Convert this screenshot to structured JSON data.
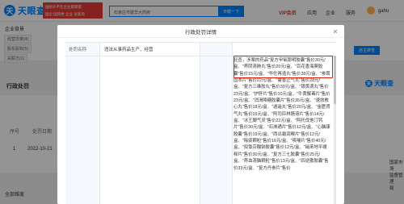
{
  "header": {
    "logo_text": "天眼查",
    "promo_lines": [
      "国际外不在企业家联盟",
      "国企 国资委 企业 试查询"
    ],
    "search_text": "石家庄市建华大药房",
    "search_button": "天眼一下",
    "vip": "VIP会员",
    "nav": [
      "应用",
      "企业",
      "服务"
    ],
    "user": "gahu"
  },
  "background": {
    "tab_title": "企业背景",
    "chips_row1": [
      "经营异常(4)",
      "股东股权(5)"
    ],
    "chips_row2": [
      "关联方(1)"
    ],
    "blue_button": "自主排查",
    "section_title": "行政处罚",
    "watermark": "天眼查",
    "table_headers": [
      "序号",
      "处罚日期"
    ],
    "row": {
      "index": "1",
      "date": "2022-10-21"
    },
    "side_text": [
      "国家市场",
      "监督管理",
      "局"
    ],
    "bottom_label": "全部维度"
  },
  "modal": {
    "title": "行政处罚详情",
    "close_icon": "close-icon",
    "rows": [
      {
        "label": "处罚名称",
        "value": "违法从事药品生产、经营"
      }
    ],
    "content": "经查，涉案的药品\"复方甲氧那明胶囊\"售价30元/盒、\"养阴清肺丸\"售价20元/盒、\"百花香海葵胶囊\"售价15元/盒、\"华佗再造丸\"售价28元/盒、\"参茸固本片\"售价22元/盒、\"藿香正气丸\"售价28元/盒、\"复方三维胶丸\"售价30元/盒、\"银黄滴丸\"售价23元/盒、\"护肝片\"售价10元/盒、\"牛黄解毒片\"售价23元/盒、\"消渴降糖胶囊片\"售价35元/盒、\"速效救心丸\"售价18元/盒、\"逍遥丸\"售价20元/盒、\"金匮肾气丸\"售价15元/盒、\"阿司匹林肠溶片\"售价14元/盒、\"冰王脚气灵\"售价22元/盒、\"阿托伐他汀钙片\"售价30元/盒、\"石淋通片\"售价12元/盒、\"心脑康胶囊\"售价19元/盒、\"西瓜霜润喉片\"售价12元/盒、\"除痰颗粒\"售价16元/盒、\"咳喘片\"售价40元/盒、\"双氯芬酸钠胶囊\"售价12元/盒、\"硝苯地平缓释片\"售价30元/盒、\"复方三七胶囊\"售价25元/盒、\"养血清脑颗粒\"售价13元/盒、\"四逆散胶囊\"售价33元/盒、\"复方丹参片\"售价"
  }
}
